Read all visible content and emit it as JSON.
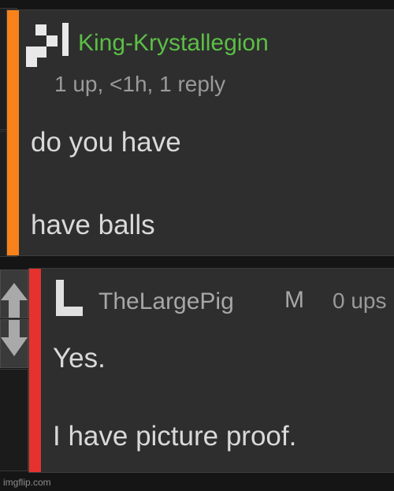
{
  "comments": [
    {
      "username": "King-Krystallegion",
      "username_color": "#5bbf45",
      "accent_color": "#f7821b",
      "meta": "1 up, <1h, 1 reply",
      "body_lines": [
        "do you have",
        "have balls"
      ]
    },
    {
      "username": "TheLargePig",
      "username_color": "#a7a7a7",
      "badge": "M",
      "meta": "0 ups",
      "accent_color": "#e6322e",
      "body_lines": [
        "Yes.",
        "I have picture proof."
      ]
    }
  ],
  "vote": {
    "up_icon": "upvote-arrow-icon",
    "down_icon": "downvote-arrow-icon"
  },
  "watermark": "imgflip.com"
}
